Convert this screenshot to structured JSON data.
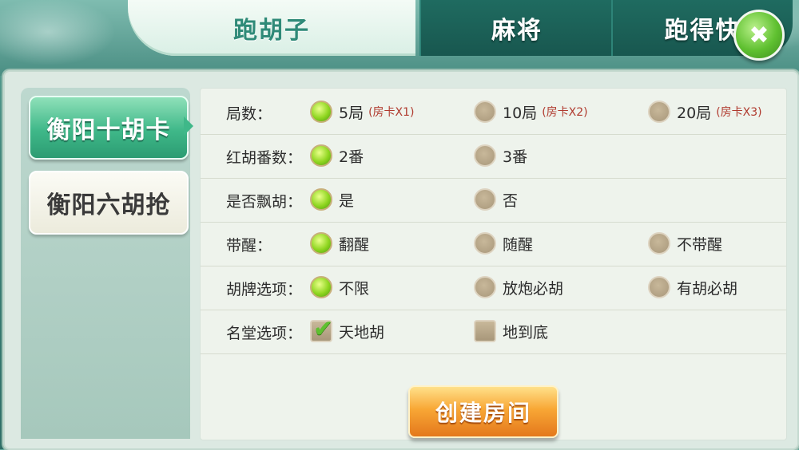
{
  "tabs": [
    {
      "label": "跑胡子",
      "active": true
    },
    {
      "label": "麻将",
      "active": false
    },
    {
      "label": "跑得快",
      "active": false
    }
  ],
  "close_button": {
    "symbol": "✖",
    "icon": "close-icon"
  },
  "sidebar": {
    "items": [
      {
        "label": "衡阳十胡卡",
        "active": true
      },
      {
        "label": "衡阳六胡抢",
        "active": false
      }
    ]
  },
  "options": [
    {
      "label": "局数：",
      "type": "radio",
      "choices": [
        {
          "text": "5局",
          "note": "(房卡X1)",
          "selected": true
        },
        {
          "text": "10局",
          "note": "(房卡X2)",
          "selected": false
        },
        {
          "text": "20局",
          "note": "(房卡X3)",
          "selected": false
        }
      ]
    },
    {
      "label": "红胡番数：",
      "type": "radio",
      "choices": [
        {
          "text": "2番",
          "selected": true
        },
        {
          "text": "3番",
          "selected": false
        }
      ]
    },
    {
      "label": "是否飘胡：",
      "type": "radio",
      "choices": [
        {
          "text": "是",
          "selected": true
        },
        {
          "text": "否",
          "selected": false
        }
      ]
    },
    {
      "label": "带醒：",
      "type": "radio",
      "choices": [
        {
          "text": "翻醒",
          "selected": true
        },
        {
          "text": "随醒",
          "selected": false
        },
        {
          "text": "不带醒",
          "selected": false
        }
      ]
    },
    {
      "label": "胡牌选项：",
      "type": "radio",
      "choices": [
        {
          "text": "不限",
          "selected": true
        },
        {
          "text": "放炮必胡",
          "selected": false
        },
        {
          "text": "有胡必胡",
          "selected": false
        }
      ]
    },
    {
      "label": "名堂选项：",
      "type": "checkbox",
      "choices": [
        {
          "text": "天地胡",
          "selected": true
        },
        {
          "text": "地到底",
          "selected": false
        }
      ]
    }
  ],
  "create_button": {
    "label": "创建房间"
  },
  "colors": {
    "accent": "#3fb889",
    "radio_on": "#8fd620",
    "button": "#f8a735"
  }
}
